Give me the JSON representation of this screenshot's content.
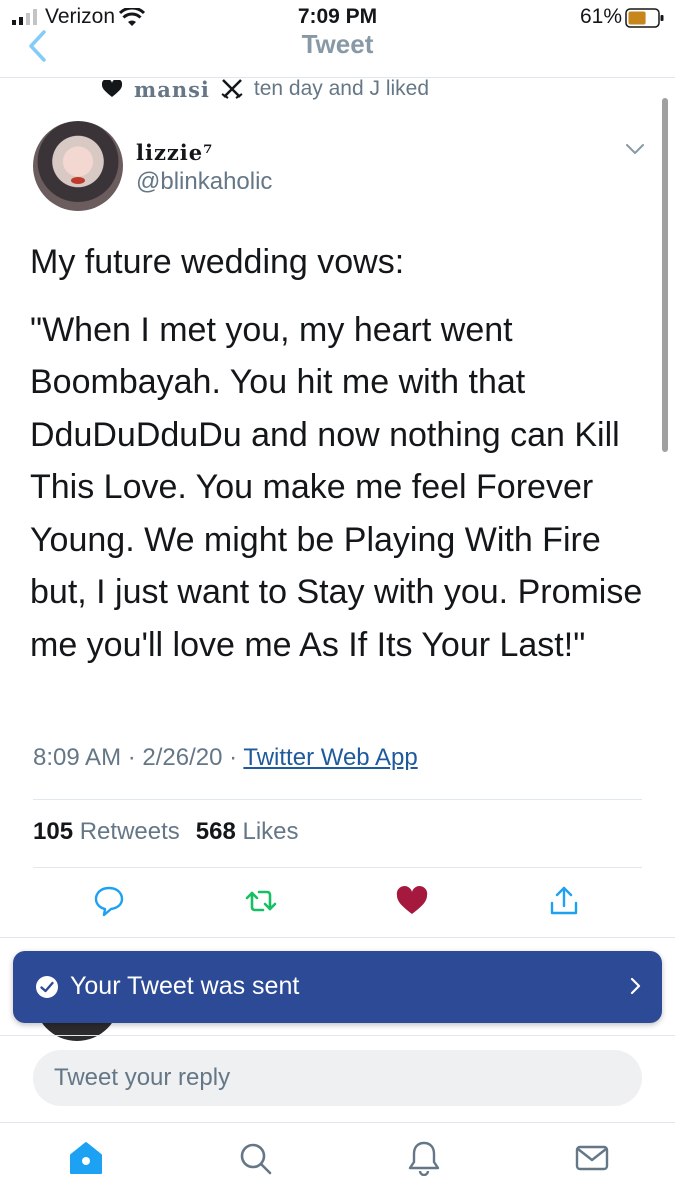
{
  "status_bar": {
    "carrier": "Verizon",
    "time": "7:09 PM",
    "battery_percent": "61%",
    "battery_level": 0.61
  },
  "nav": {
    "title": "Tweet",
    "back_icon": "chevron-left-icon"
  },
  "social_context": {
    "name": "mansi",
    "text": "ten day and J liked"
  },
  "tweet": {
    "display_name": "lizzie⁷",
    "handle": "@blinkaholic",
    "paragraphs": [
      "My future wedding vows:",
      "\"When I met you, my heart went Boombayah. You hit me with that DduDuDduDu and now nothing can Kill This Love. You make me feel Forever Young. We might be Playing With Fire but, I just want to Stay with you. Promise me you'll love me As If Its Your Last!\""
    ],
    "time": "8:09 AM",
    "date": "2/26/20",
    "separator": "·",
    "source": "Twitter Web App",
    "retweet_count": "105",
    "retweet_label": "Retweets",
    "like_count": "568",
    "like_label": "Likes",
    "liked": true
  },
  "toast": {
    "text": "Your Tweet was sent"
  },
  "reply": {
    "placeholder": "Tweet your reply"
  },
  "colors": {
    "accent": "#1da1f2",
    "toast_bg": "#2d4a96",
    "like_red": "#a4193d",
    "retweet_green": "#17bf63",
    "secondary_text": "#657786"
  },
  "tab_bar": [
    "home-icon",
    "search-icon",
    "notifications-icon",
    "messages-icon"
  ]
}
